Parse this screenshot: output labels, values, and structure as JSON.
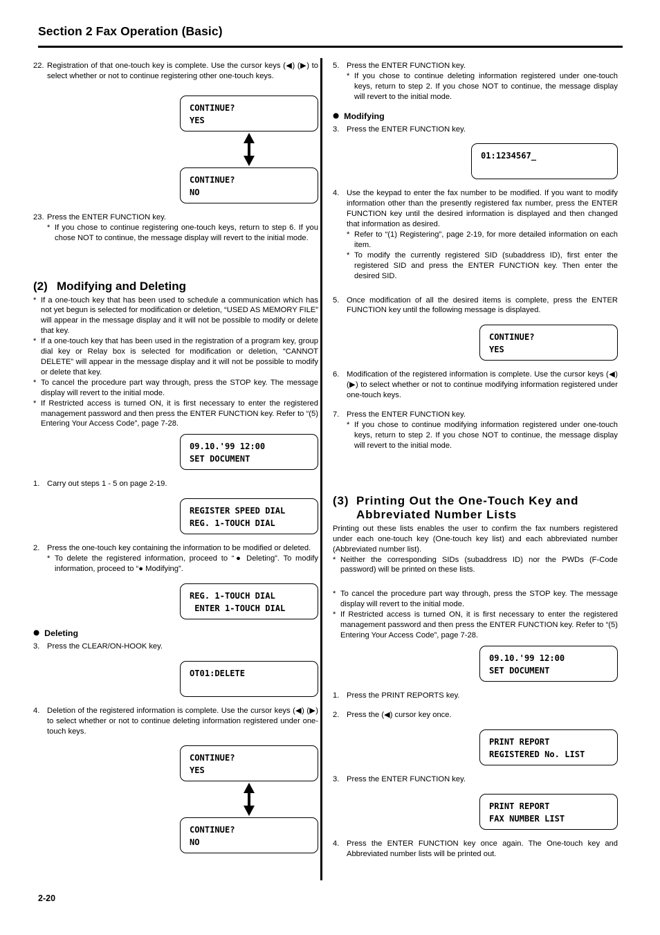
{
  "page": {
    "header_title": "Section 2   Fax Operation (Basic)",
    "footer_page_number": "2-20"
  },
  "left_column": {
    "step22": {
      "num": "22.",
      "text": "Registration of that one-touch key is complete. Use the cursor keys (◀) (▶) to select whether or not to continue registering other one-touch keys."
    },
    "lcd_continue_yes_1": {
      "line1": "CONTINUE?",
      "line2": "YES"
    },
    "lcd_continue_no_1": {
      "line1": "CONTINUE?",
      "line2": "NO"
    },
    "step23": {
      "num": "23.",
      "text": "Press the ENTER FUNCTION key.",
      "note": "If you chose to continue registering one-touch keys, return to step 6. If you chose NOT to continue, the message display will revert to the initial mode."
    },
    "heading_2": {
      "number": "(2)",
      "title": "Modifying and Deleting"
    },
    "notes": [
      "If a one-touch key that has been used to schedule a communication which has not yet begun is selected for modification or deletion, “USED AS MEMORY FILE” will appear in the message display and it will not be possible to modify or delete that key.",
      "If a one-touch key that has been used in the registration of a program key, group dial key or Relay box is selected for modification or deletion, “CANNOT DELETE” will appear in the message display and it will not be possible to modify or delete that key.",
      "To cancel the procedure part way through, press the STOP key. The message display will revert to the initial mode.",
      "If Restricted access is turned ON, it is first necessary to enter the registered management password and then press the ENTER FUNCTION key. Refer to “(5) Entering Your Access Code”, page 7-28."
    ],
    "lcd_initial": {
      "line1": "09.10.'99 12:00",
      "line2": "SET DOCUMENT"
    },
    "step1": {
      "num": "1.",
      "text": "Carry out steps 1 - 5 on page 2-19."
    },
    "lcd_register_speed_dial": {
      "line1": "REGISTER SPEED DIAL",
      "line2": "REG. 1-TOUCH DIAL"
    },
    "step2": {
      "num": "2.",
      "text": "Press the one-touch key containing the information to be modified or deleted.",
      "note": "To delete the registered information, proceed to “● Deleting”. To modify information, proceed to “● Modifying”."
    },
    "lcd_enter_one_touch": {
      "line1": "REG. 1-TOUCH DIAL",
      "line2": " ENTER 1-TOUCH DIAL"
    },
    "heading_deleting": "Deleting",
    "step3": {
      "num": "3.",
      "text": "Press the CLEAR/ON-HOOK key."
    },
    "lcd_ot01_delete": {
      "line1": "OT01:DELETE",
      "line2": ""
    },
    "step4": {
      "num": "4.",
      "text": "Deletion of the registered information is complete. Use the cursor keys (◀) (▶) to select whether or not to continue deleting information registered under one-touch keys."
    },
    "lcd_continue_yes_2": {
      "line1": "CONTINUE?",
      "line2": "YES"
    },
    "lcd_continue_no_2": {
      "line1": "CONTINUE?",
      "line2": "NO"
    }
  },
  "right_column": {
    "step5_deleting": {
      "num": "5.",
      "text": "Press the ENTER FUNCTION key.",
      "note": "If you chose to continue deleting information registered under one-touch keys, return to step 2. If you chose NOT to continue, the message display will revert to the initial mode."
    },
    "heading_modifying": "Modifying",
    "step3": {
      "num": "3.",
      "text": "Press the ENTER FUNCTION key."
    },
    "lcd_fax_number": {
      "line1": "01:1234567_",
      "line2": ""
    },
    "step4": {
      "num": "4.",
      "text": "Use the keypad to enter the fax number to be modified. If you want to modify information other than the presently registered fax number, press the ENTER FUNCTION key until the desired information is displayed and then changed that information as desired.",
      "note1": "Refer to “(1) Registering”, page 2-19, for more detailed information on each item.",
      "note2": "To modify the currently registered SID (subaddress ID), first enter the registered SID and press the ENTER FUNCTION key. Then enter the desired SID."
    },
    "step5": {
      "num": "5.",
      "text": "Once modification of all the desired items is complete, press the ENTER FUNCTION key until the following message is displayed."
    },
    "lcd_continue_yes": {
      "line1": "CONTINUE?",
      "line2": "YES"
    },
    "step6": {
      "num": "6.",
      "text": "Modification of the registered information is complete. Use the cursor keys (◀) (▶) to select whether or not to continue modifying information registered under one-touch keys."
    },
    "step7": {
      "num": "7.",
      "text": "Press the ENTER FUNCTION key.",
      "note": "If you chose to continue modifying information registered under one-touch keys, return to step 2. If you chose NOT to continue, the message display will revert to the initial mode."
    },
    "heading_3": {
      "number": "(3)",
      "title_line1": "Printing Out the One-Touch Key and",
      "title_line2": "Abbreviated Number Lists"
    },
    "intro": "Printing out these lists enables the user to confirm the fax numbers registered under each one-touch key (One-touch key list) and each abbreviated number (Abbreviated number list).",
    "notes": [
      "Neither the corresponding SIDs (subaddress ID) nor the PWDs (F-Code password) will be printed on these lists.",
      "To cancel the procedure part way through, press the STOP key. The message display will revert to the initial mode.",
      "If Restricted access is turned ON, it is first necessary to enter the registered management password and then press the ENTER FUNCTION key. Refer to “(5) Entering Your Access Code”, page 7-28."
    ],
    "lcd_initial": {
      "line1": "09.10.'99 12:00",
      "line2": "SET DOCUMENT"
    },
    "print_step1": {
      "num": "1.",
      "text": "Press the PRINT REPORTS key."
    },
    "print_step2": {
      "num": "2.",
      "text": "Press the (◀) cursor key once."
    },
    "lcd_registered_no_list": {
      "line1": "PRINT REPORT",
      "line2": "REGISTERED No. LIST"
    },
    "print_step3": {
      "num": "3.",
      "text": "Press the ENTER FUNCTION key."
    },
    "lcd_fax_number_list": {
      "line1": "PRINT REPORT",
      "line2": "FAX NUMBER LIST"
    },
    "print_step4": {
      "num": "4.",
      "text": "Press the ENTER FUNCTION key once again. The One-touch key and Abbreviated number lists will be printed out."
    }
  },
  "symbols": {
    "star": "*",
    "bullet": "●"
  }
}
